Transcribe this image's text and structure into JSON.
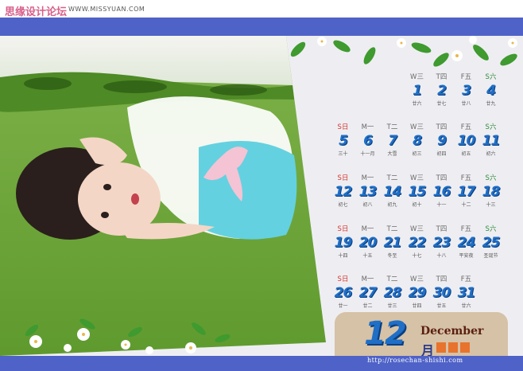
{
  "header": {
    "site_title": "思缘设计论坛",
    "site_url": "WWW.MISSYUAN.COM"
  },
  "calendar": {
    "month_number": "12",
    "month_name_en": "December",
    "month_name_cn": "月",
    "footer_url": "http://rosechan-shishi.com",
    "weeks": [
      [
        {
          "wd": "W三",
          "day": "1",
          "lunar": "廿六"
        },
        {
          "wd": "T四",
          "day": "2",
          "lunar": "廿七"
        },
        {
          "wd": "F五",
          "day": "3",
          "lunar": "廿八"
        },
        {
          "wd": "S六",
          "day": "4",
          "lunar": "廿九"
        }
      ],
      [
        {
          "wd": "S日",
          "day": "5",
          "lunar": "三十"
        },
        {
          "wd": "M一",
          "day": "6",
          "lunar": "十一月"
        },
        {
          "wd": "T二",
          "day": "7",
          "lunar": "大雪"
        },
        {
          "wd": "W三",
          "day": "8",
          "lunar": "初三"
        },
        {
          "wd": "T四",
          "day": "9",
          "lunar": "初四"
        },
        {
          "wd": "F五",
          "day": "10",
          "lunar": "初五"
        },
        {
          "wd": "S六",
          "day": "11",
          "lunar": "初六"
        }
      ],
      [
        {
          "wd": "S日",
          "day": "12",
          "lunar": "初七"
        },
        {
          "wd": "M一",
          "day": "13",
          "lunar": "初八"
        },
        {
          "wd": "T二",
          "day": "14",
          "lunar": "初九"
        },
        {
          "wd": "W三",
          "day": "15",
          "lunar": "初十"
        },
        {
          "wd": "T四",
          "day": "16",
          "lunar": "十一"
        },
        {
          "wd": "F五",
          "day": "17",
          "lunar": "十二"
        },
        {
          "wd": "S六",
          "day": "18",
          "lunar": "十三"
        }
      ],
      [
        {
          "wd": "S日",
          "day": "19",
          "lunar": "十四"
        },
        {
          "wd": "M一",
          "day": "20",
          "lunar": "十五"
        },
        {
          "wd": "T二",
          "day": "21",
          "lunar": "冬至"
        },
        {
          "wd": "W三",
          "day": "22",
          "lunar": "十七"
        },
        {
          "wd": "T四",
          "day": "23",
          "lunar": "十八"
        },
        {
          "wd": "F五",
          "day": "24",
          "lunar": "平安夜"
        },
        {
          "wd": "S六",
          "day": "25",
          "lunar": "圣诞节"
        }
      ],
      [
        {
          "wd": "S日",
          "day": "26",
          "lunar": "廿一"
        },
        {
          "wd": "M一",
          "day": "27",
          "lunar": "廿二"
        },
        {
          "wd": "T二",
          "day": "28",
          "lunar": "廿三"
        },
        {
          "wd": "W三",
          "day": "29",
          "lunar": "廿四"
        },
        {
          "wd": "T四",
          "day": "30",
          "lunar": "廿五"
        },
        {
          "wd": "F五",
          "day": "31",
          "lunar": "廿六"
        }
      ]
    ]
  },
  "colors": {
    "band": "#4f62c8",
    "day_number": "#1f6fc7",
    "sunday": "#d6342f",
    "saturday": "#2f8a3a",
    "badge": "#d6c2a6"
  }
}
